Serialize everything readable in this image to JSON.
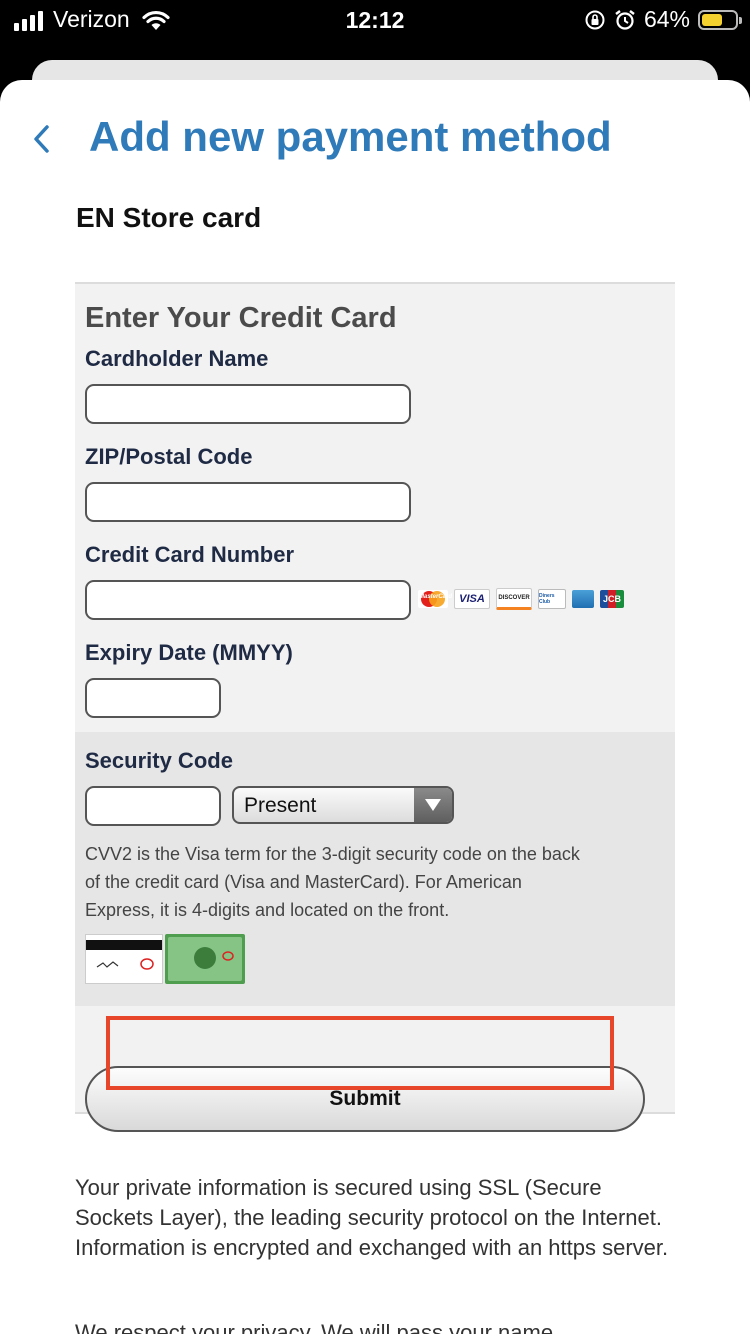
{
  "status": {
    "carrier": "Verizon",
    "time": "12:12",
    "battery_text": "64%",
    "battery_level": 0.64
  },
  "header": {
    "title": "Add new payment method",
    "subtitle": "EN Store card"
  },
  "form": {
    "heading": "Enter Your Credit Card",
    "cardholder_label": "Cardholder Name",
    "cardholder_value": "",
    "zip_label": "ZIP/Postal Code",
    "zip_value": "",
    "card_number_label": "Credit Card Number",
    "card_number_value": "",
    "card_brands": [
      {
        "icon": "mastercard-icon",
        "text": "MasterCard"
      },
      {
        "icon": "visa-icon",
        "text": "VISA"
      },
      {
        "icon": "discover-icon",
        "text": "DISCOVER"
      },
      {
        "icon": "diners-club-icon",
        "text": "Diners Club"
      },
      {
        "icon": "american-express-icon",
        "text": ""
      },
      {
        "icon": "jcb-icon",
        "text": "JCB"
      }
    ],
    "expiry_label": "Expiry Date (MMYY)",
    "expiry_value": "",
    "security_label": "Security Code",
    "security_value": "",
    "security_select": "Present",
    "cvv_help": "CVV2 is the Visa term for the 3-digit security code on the back of the credit card (Visa and MasterCard). For American Express, it is 4-digits and located on the front.",
    "submit_label": "Submit"
  },
  "footer": {
    "ssl_text": "Your private information is secured using SSL (Secure Sockets Layer), the leading security protocol on the Internet. Information is encrypted and exchanged with an https server.",
    "privacy_text": "We respect your privacy. We will pass your name"
  },
  "colors": {
    "title": "#2f7ab9",
    "highlight": "#e8462a",
    "battery": "#f5d130"
  }
}
